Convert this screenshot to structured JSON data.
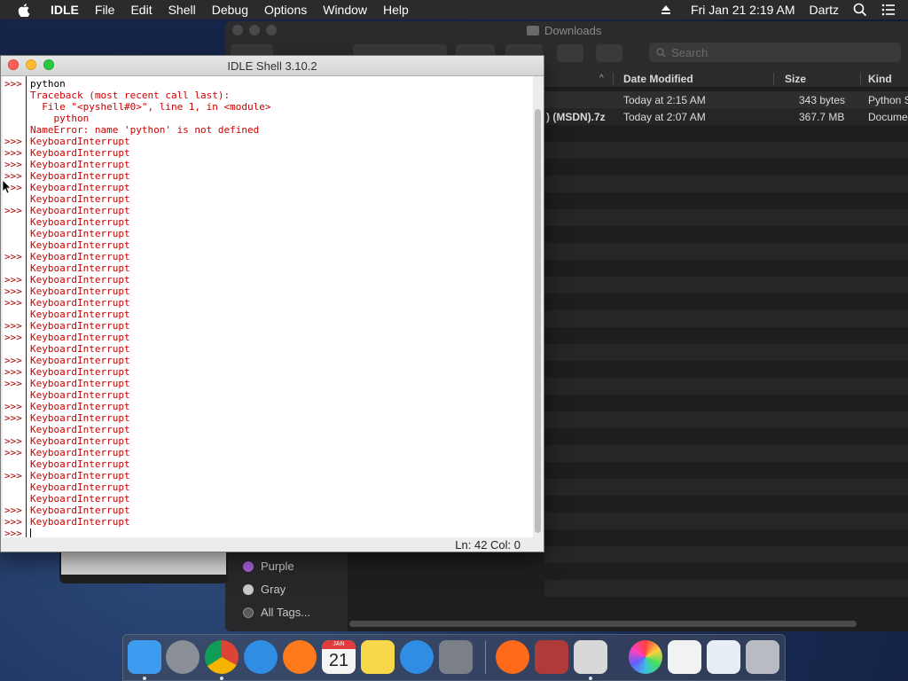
{
  "menubar": {
    "app": "IDLE",
    "items": [
      "File",
      "Edit",
      "Shell",
      "Debug",
      "Options",
      "Window",
      "Help"
    ],
    "clock": "Fri Jan 21  2:19 AM",
    "user": "Dartz"
  },
  "finder": {
    "title": "Downloads",
    "search_placeholder": "Search",
    "columns": [
      "Date Modified",
      "Size",
      "Kind"
    ],
    "rows": [
      {
        "name": "",
        "date": "Today at 2:15 AM",
        "size": "343 bytes",
        "kind": "Python S"
      },
      {
        "name": ") (MSDN).7z",
        "date": "Today at 2:07 AM",
        "size": "367.7 MB",
        "kind": "Docume"
      }
    ],
    "tags": [
      {
        "label": "Purple",
        "color": "#a75fd8"
      },
      {
        "label": "Gray",
        "color": "#c8c8c8"
      },
      {
        "label": "All Tags...",
        "color": "#5a5a5a"
      }
    ]
  },
  "idle": {
    "title": "IDLE Shell 3.10.2",
    "prompt": ">>>",
    "status": "Ln: 42  Col: 0",
    "lines": [
      {
        "p": true,
        "t": "python",
        "c": "black"
      },
      {
        "p": false,
        "t": "Traceback (most recent call last):",
        "c": "red"
      },
      {
        "p": false,
        "t": "  File \"<pyshell#0>\", line 1, in <module>",
        "c": "red"
      },
      {
        "p": false,
        "t": "    python",
        "c": "red"
      },
      {
        "p": false,
        "t": "NameError: name 'python' is not defined",
        "c": "red"
      },
      {
        "p": true,
        "t": "KeyboardInterrupt",
        "c": "red"
      },
      {
        "p": true,
        "t": "KeyboardInterrupt",
        "c": "red"
      },
      {
        "p": true,
        "t": "KeyboardInterrupt",
        "c": "red"
      },
      {
        "p": true,
        "t": "KeyboardInterrupt",
        "c": "red"
      },
      {
        "p": true,
        "t": "KeyboardInterrupt",
        "c": "red"
      },
      {
        "p": false,
        "t": "KeyboardInterrupt",
        "c": "red"
      },
      {
        "p": true,
        "t": "KeyboardInterrupt",
        "c": "red"
      },
      {
        "p": false,
        "t": "KeyboardInterrupt",
        "c": "red"
      },
      {
        "p": false,
        "t": "KeyboardInterrupt",
        "c": "red"
      },
      {
        "p": false,
        "t": "KeyboardInterrupt",
        "c": "red"
      },
      {
        "p": true,
        "t": "KeyboardInterrupt",
        "c": "red"
      },
      {
        "p": false,
        "t": "KeyboardInterrupt",
        "c": "red"
      },
      {
        "p": true,
        "t": "KeyboardInterrupt",
        "c": "red"
      },
      {
        "p": true,
        "t": "KeyboardInterrupt",
        "c": "red"
      },
      {
        "p": true,
        "t": "KeyboardInterrupt",
        "c": "red"
      },
      {
        "p": false,
        "t": "KeyboardInterrupt",
        "c": "red"
      },
      {
        "p": true,
        "t": "KeyboardInterrupt",
        "c": "red"
      },
      {
        "p": true,
        "t": "KeyboardInterrupt",
        "c": "red"
      },
      {
        "p": false,
        "t": "KeyboardInterrupt",
        "c": "red"
      },
      {
        "p": true,
        "t": "KeyboardInterrupt",
        "c": "red"
      },
      {
        "p": true,
        "t": "KeyboardInterrupt",
        "c": "red"
      },
      {
        "p": true,
        "t": "KeyboardInterrupt",
        "c": "red"
      },
      {
        "p": false,
        "t": "KeyboardInterrupt",
        "c": "red"
      },
      {
        "p": true,
        "t": "KeyboardInterrupt",
        "c": "red"
      },
      {
        "p": true,
        "t": "KeyboardInterrupt",
        "c": "red"
      },
      {
        "p": false,
        "t": "KeyboardInterrupt",
        "c": "red"
      },
      {
        "p": true,
        "t": "KeyboardInterrupt",
        "c": "red"
      },
      {
        "p": true,
        "t": "KeyboardInterrupt",
        "c": "red"
      },
      {
        "p": false,
        "t": "KeyboardInterrupt",
        "c": "red"
      },
      {
        "p": true,
        "t": "KeyboardInterrupt",
        "c": "red"
      },
      {
        "p": false,
        "t": "KeyboardInterrupt",
        "c": "red"
      },
      {
        "p": false,
        "t": "KeyboardInterrupt",
        "c": "red"
      },
      {
        "p": true,
        "t": "KeyboardInterrupt",
        "c": "red"
      },
      {
        "p": true,
        "t": "KeyboardInterrupt",
        "c": "red"
      },
      {
        "p": true,
        "t": "",
        "c": "black"
      }
    ]
  },
  "dock": {
    "apps": [
      {
        "name": "finder-app-icon",
        "color": "#3d9bf0",
        "running": true
      },
      {
        "name": "launchpad-app-icon",
        "color": "#8a8f98",
        "running": false
      },
      {
        "name": "chrome-app-icon",
        "color": "#e8e8e8",
        "running": true
      },
      {
        "name": "safari-app-icon",
        "color": "#2f8de4",
        "running": false
      },
      {
        "name": "firefox-app-icon",
        "color": "#ff7a1a",
        "running": false
      },
      {
        "name": "calendar-app-icon",
        "color": "#f4f4f4",
        "running": false
      },
      {
        "name": "notes-app-icon",
        "color": "#f7d84a",
        "running": false
      },
      {
        "name": "app-store-app-icon",
        "color": "#2f8de4",
        "running": false
      },
      {
        "name": "system-preferences-app-icon",
        "color": "#7b7f87",
        "running": false
      },
      {
        "name": "firefox-downloads-app-icon",
        "color": "#ff6a1a",
        "running": false
      },
      {
        "name": "dictionary-app-icon",
        "color": "#b03a3a",
        "running": false
      },
      {
        "name": "idle-app-icon",
        "color": "#d8d8d8",
        "running": true
      },
      {
        "name": "color-picker-app-icon",
        "color": "#40c0e0",
        "running": false
      },
      {
        "name": "python-file-icon",
        "color": "#f2f2f2",
        "running": false
      },
      {
        "name": "preview-app-icon",
        "color": "#e8eef5",
        "running": false
      },
      {
        "name": "trash-icon",
        "color": "#b8bcc2",
        "running": false
      }
    ],
    "calendar_month": "JAN",
    "calendar_day": "21"
  }
}
